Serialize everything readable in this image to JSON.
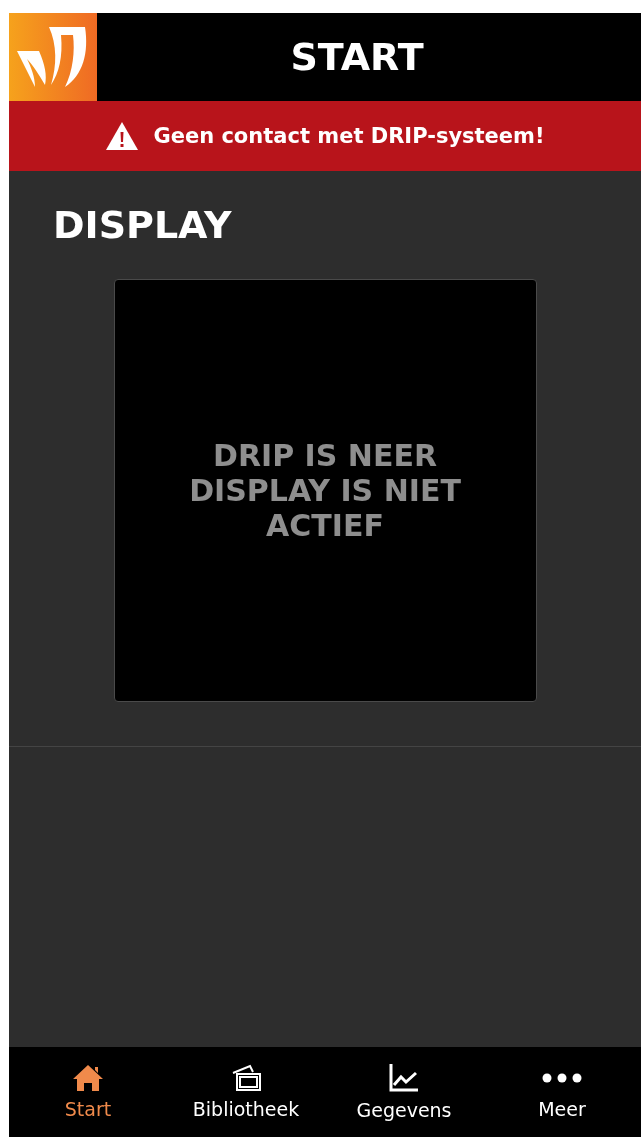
{
  "header": {
    "title": "START"
  },
  "alert": {
    "message": "Geen contact met DRIP-systeem!"
  },
  "section": {
    "title": "DISPLAY"
  },
  "display": {
    "lines": [
      "DRIP IS NEER",
      "DISPLAY IS NIET",
      "ACTIEF"
    ]
  },
  "tabs": [
    {
      "kind": "home",
      "label": "Start",
      "selected": true
    },
    {
      "kind": "library",
      "label": "Bibliotheek",
      "selected": false
    },
    {
      "kind": "chart",
      "label": "Gegevens",
      "selected": false
    },
    {
      "kind": "more",
      "label": "Meer",
      "selected": false
    }
  ]
}
